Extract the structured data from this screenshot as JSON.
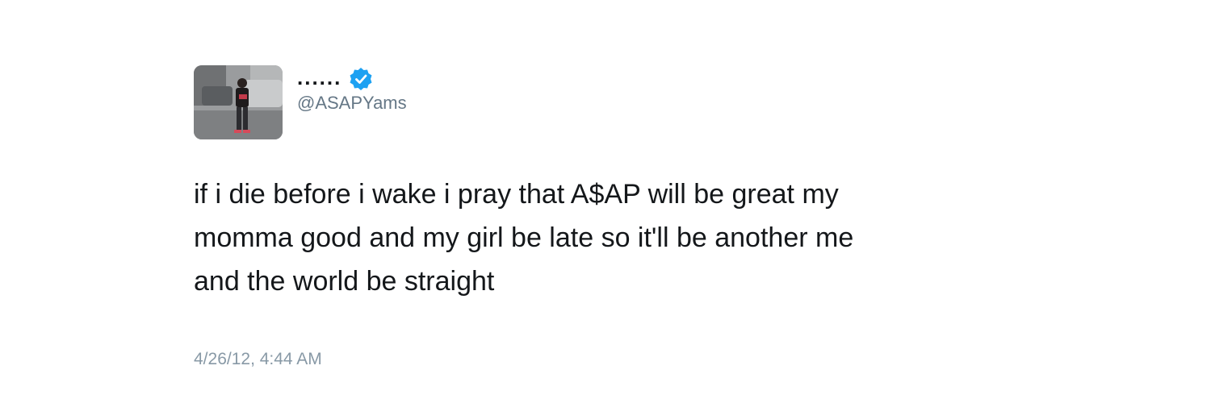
{
  "tweet": {
    "display_name": "......",
    "handle": "@ASAPYams",
    "verified": true,
    "text": "if i die before i wake i pray that A$AP will be great my momma good and my girl be late so it'll be another me and the world be straight",
    "timestamp": "4/26/12, 4:44 AM"
  },
  "icons": {
    "verified": "verified-badge-icon"
  },
  "colors": {
    "verified_badge": "#1da1f2",
    "handle": "#657786",
    "timestamp": "#8899a6",
    "text": "#14171a"
  }
}
